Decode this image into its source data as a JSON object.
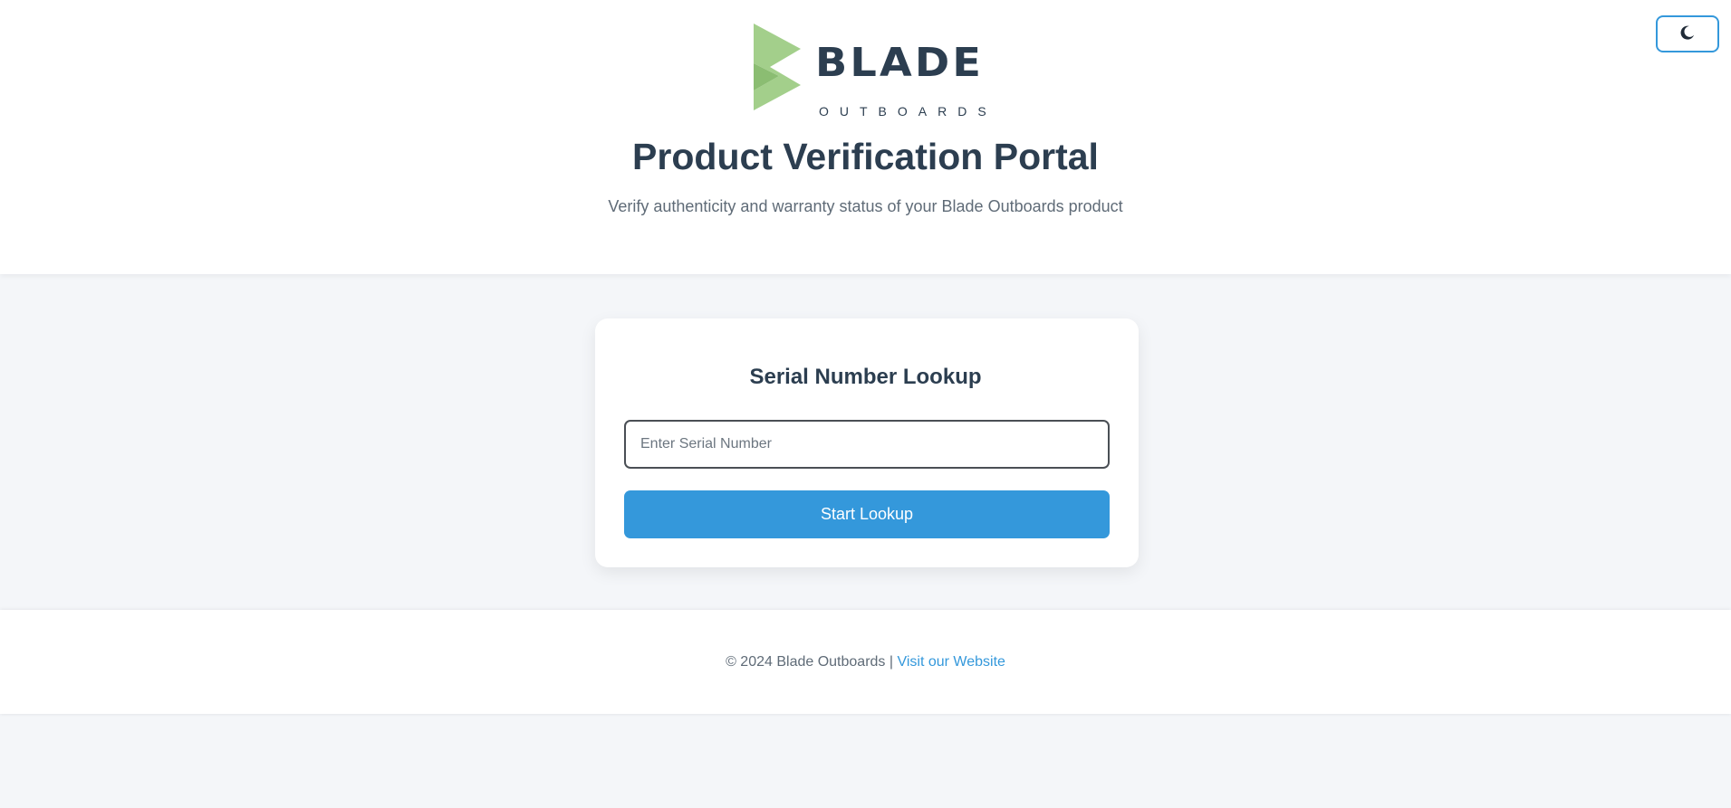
{
  "header": {
    "theme_toggle_icon": "moon-icon",
    "logo": {
      "wordmark": "BLADE",
      "subword": "OUTBOARDS",
      "mark_color": "#a3cf8b"
    },
    "title": "Product Verification Portal",
    "subtitle": "Verify authenticity and warranty status of your Blade Outboards product"
  },
  "lookup": {
    "title": "Serial Number Lookup",
    "input_placeholder": "Enter Serial Number",
    "input_value": "",
    "button_label": "Start Lookup"
  },
  "footer": {
    "copyright": "© 2024 Blade Outboards |",
    "link_label": "Visit our Website"
  },
  "colors": {
    "accent": "#3498db",
    "heading": "#2c3e50",
    "page_background": "#f4f6f9"
  }
}
